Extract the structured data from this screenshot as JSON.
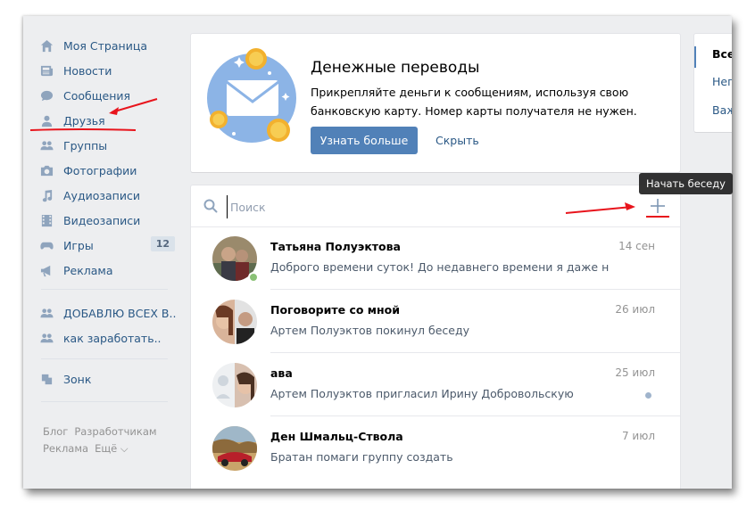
{
  "sidebar": {
    "items": [
      {
        "label": "Моя Страница",
        "icon": "home-icon"
      },
      {
        "label": "Новости",
        "icon": "news-icon"
      },
      {
        "label": "Сообщения",
        "icon": "messages-icon"
      },
      {
        "label": "Друзья",
        "icon": "friends-icon"
      },
      {
        "label": "Группы",
        "icon": "groups-icon"
      },
      {
        "label": "Фотографии",
        "icon": "camera-icon"
      },
      {
        "label": "Аудиозаписи",
        "icon": "music-note-icon"
      },
      {
        "label": "Видеозаписи",
        "icon": "film-icon"
      },
      {
        "label": "Игры",
        "icon": "gamepad-icon",
        "badge": "12"
      },
      {
        "label": "Реклама",
        "icon": "megaphone-icon"
      }
    ],
    "groups": [
      {
        "label": "ДОБАВЛЮ ВСЕХ В..",
        "icon": "community-icon"
      },
      {
        "label": "как заработать..",
        "icon": "community-icon"
      }
    ],
    "apps": [
      {
        "label": "Зонк",
        "icon": "app-icon"
      }
    ],
    "footer": {
      "blog": "Блог",
      "developers": "Разработчикам",
      "ads": "Реклама",
      "more": "Ещё ⌵"
    }
  },
  "banner": {
    "title": "Денежные переводы",
    "text": "Прикрепляйте деньги к сообщениям, используя свою банковскую карту. Номер карты получателя не нужен.",
    "primary_button": "Узнать больше",
    "hide_link": "Скрыть"
  },
  "messages": {
    "search_placeholder": "Поиск",
    "new_chat_tooltip": "Начать беседу",
    "dialogs": [
      {
        "name": "Татьяна Полуэктова",
        "date": "14 сен",
        "preview": "Доброго времени суток! До недавнего времени я даже не с...",
        "online": true
      },
      {
        "name": "Поговорите со мной",
        "date": "26 июл",
        "preview": "Артем Полуэктов покинул беседу",
        "online": false
      },
      {
        "name": "ава",
        "date": "25 июл",
        "preview": "Артем Полуэктов пригласил Ирину Добровольскую",
        "unread": true
      },
      {
        "name": "Ден Шмальц-Ствола",
        "date": "7 июл",
        "preview": "Братан помаги группу создать",
        "online": false
      }
    ]
  },
  "right_panel": {
    "items": [
      "Все",
      "Неп",
      "Важ"
    ]
  },
  "colors": {
    "link": "#2a5885",
    "accent": "#5181b8",
    "background": "#edeef0",
    "annotation": "#e8141c",
    "online": "#8ac176"
  }
}
